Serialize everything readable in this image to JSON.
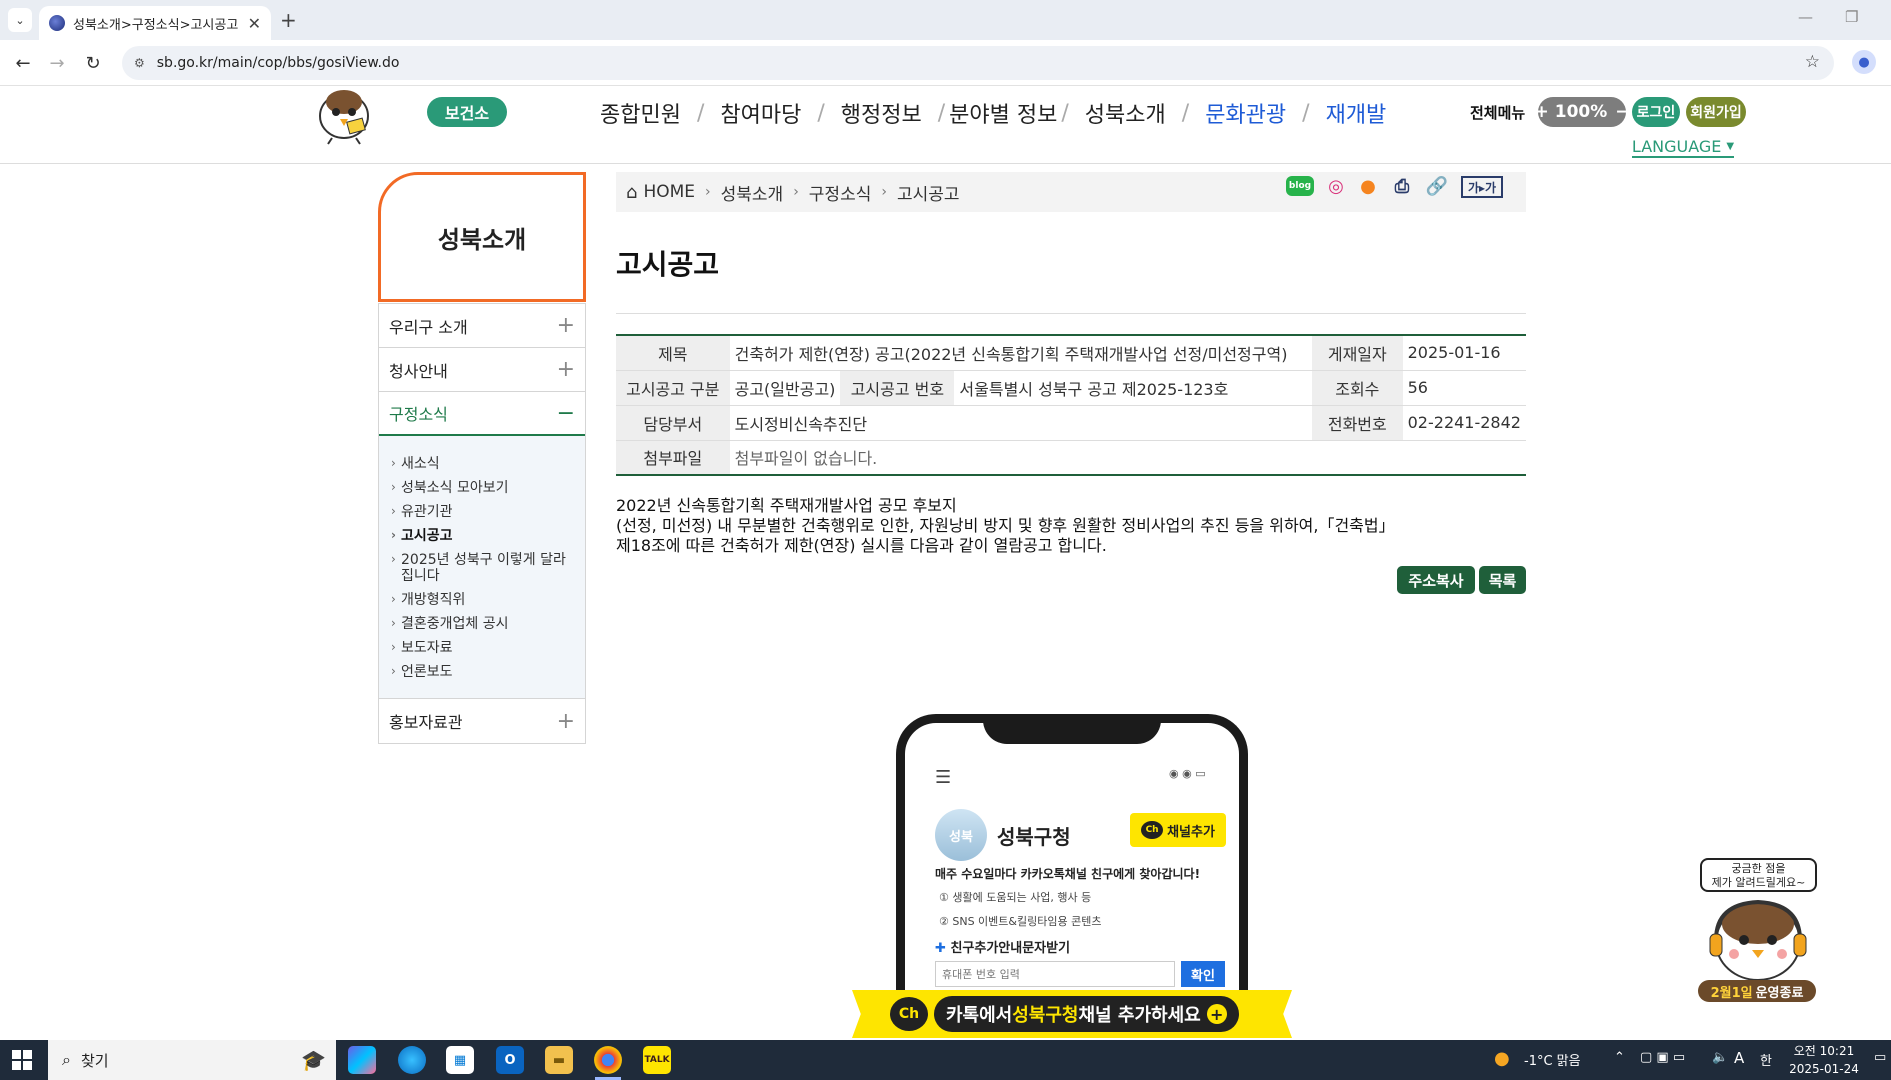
{
  "browser": {
    "tab_title": "성북소개>구정소식>고시공고",
    "url": "sb.go.kr/main/cop/bbs/gosiView.do",
    "icons": [
      "tab-search-icon",
      "close-icon",
      "new-tab-icon",
      "back-icon",
      "forward-icon",
      "reload-icon",
      "site-info-icon",
      "bookmark-star-icon",
      "profile-icon"
    ]
  },
  "header": {
    "health_label": "보건소",
    "gnb": [
      {
        "label": "종합민원"
      },
      {
        "label": "참여마당"
      },
      {
        "label": "행정정보"
      },
      {
        "label": "분야별 정보"
      },
      {
        "label": "성북소개"
      },
      {
        "label": "문화관광"
      },
      {
        "label": "재개발"
      }
    ],
    "all_menu": "전체메뉴",
    "zoom_plus": "+",
    "zoom_value": "100%",
    "zoom_minus": "−",
    "login": "로그인",
    "join": "회원가입",
    "language": "LANGUAGE",
    "accent_color": "#2a9a78"
  },
  "lnb": {
    "title": "성북소개",
    "items": [
      {
        "label": "우리구 소개",
        "sign": "+"
      },
      {
        "label": "청사안내",
        "sign": "+"
      },
      {
        "label": "구정소식",
        "sign": "−"
      },
      {
        "label": "홍보자료관",
        "sign": "+"
      }
    ],
    "sub_items": [
      {
        "label": "새소식"
      },
      {
        "label": "성북소식 모아보기"
      },
      {
        "label": "유관기관"
      },
      {
        "label": "고시공고"
      },
      {
        "label": "2025년 성북구 이렇게 달라집니다"
      },
      {
        "label": "개방형직위"
      },
      {
        "label": "결혼중개업체 공시"
      },
      {
        "label": "보도자료"
      },
      {
        "label": "언론보도"
      }
    ]
  },
  "breadcrumb": {
    "home": "HOME",
    "items": [
      "성북소개",
      "구정소식",
      "고시공고"
    ]
  },
  "toolbar": {
    "blog": "blog",
    "font_size": "가▸가"
  },
  "page": {
    "title": "고시공고",
    "table": {
      "title_label": "제목",
      "title_value": "건축허가 제한(연장) 공고(2022년 신속통합기획 주택재개발사업 선정/미선정구역)",
      "date_label": "게재일자",
      "date_value": "2025-01-16",
      "type_label": "고시공고 구분",
      "type_value": "공고(일반공고)",
      "number_label": "고시공고 번호",
      "number_value": "서울특별시 성북구 공고 제2025-123호",
      "views_label": "조회수",
      "views_value": "56",
      "dept_label": "담당부서",
      "dept_value": "도시정비신속추진단",
      "phone_label": "전화번호",
      "phone_value": "02-2241-2842",
      "file_label": "첨부파일",
      "file_value": "첨부파일이 없습니다."
    },
    "body": {
      "line1": "2022년 신속통합기획 주택재개발사업 공모 후보지",
      "line2": "(선정, 미선정) 내 무분별한 건축행위로 인한, 자원낭비 방지 및 향후 원활한 정비사업의 추진 등을 위하여,「건축법」",
      "line3": "제18조에 따른 건축허가 제한(연장) 실시를 다음과 같이 열람공고 합니다."
    },
    "copy_button": "주소복사",
    "list_button": "목록"
  },
  "kakao": {
    "phone_avatar": "성북",
    "phone_name": "성북구청",
    "ch_label": "Ch",
    "add_channel": "채널추가",
    "line1": "매주 수요일마다 카카오톡채널 친구에게 찾아갑니다!",
    "line2": "① 생활에 도움되는 사업, 행사 등",
    "line3": "② SNS 이벤트&킬링타임용 콘텐츠",
    "line4": "친구추가안내문자받기",
    "input_placeholder": "휴대폰 번호 입력",
    "ok": "확인",
    "banner_pre": "카톡에서 ",
    "banner_hl": "성북구청",
    "banner_post": " 채널 추가하세요",
    "banner_color": "#fee500"
  },
  "chatbot": {
    "bubble_line1": "궁금한 점을",
    "bubble_line2": "제가 알려드릴게요~",
    "end_hl": "2월1일",
    "end_text": "운영종료"
  },
  "taskbar": {
    "search": "찾기",
    "weather": "-1°C 맑음",
    "ime": "A",
    "time": "오전 10:21",
    "date": "2025-01-24"
  }
}
